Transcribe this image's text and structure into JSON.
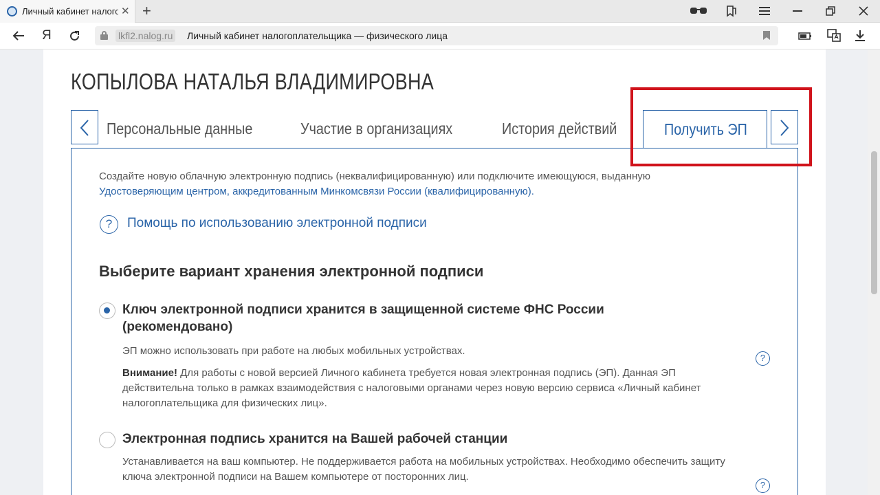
{
  "browser": {
    "tab_title": "Личный кабинет налогоплательщика",
    "tab_close": "✕",
    "new_tab": "+",
    "url_domain": "lkfl2.nalog.ru",
    "url_title": "Личный кабинет налогоплательщика — физического лица",
    "yandex_label": "Я"
  },
  "page": {
    "person_name": "КОПЫЛОВА НАТАЛЬЯ ВЛАДИМИРОВНА",
    "tabs": [
      {
        "label": "Персональные данные"
      },
      {
        "label": "Участие в организациях"
      },
      {
        "label": "История действий"
      },
      {
        "label": "Получить ЭП",
        "active": true
      }
    ],
    "intro_text_1": "Создайте новую облачную электронную подпись (неквалифицированную) или подключите имеющуюся, выданную",
    "intro_link": "Удостоверяющим центром, аккредитованным Минкомсвязи России (квалифицированную).",
    "help_icon": "?",
    "help_link": "Помощь по использованию электронной подписи",
    "section_title": "Выберите вариант хранения электронной подписи",
    "options": [
      {
        "title": "Ключ электронной подписи хранится в защищенной системе ФНС России (рекомендовано)",
        "desc": "ЭП можно использовать при работе на любых мобильных устройствах.",
        "warning_label": "Внимание!",
        "warning_text": " Для работы с новой версией Личного кабинета требуется новая электронная подпись (ЭП). Данная ЭП действительна только в рамках взаимодействия с налоговыми органами через новую версию сервиса «Личный кабинет налогоплательщика для физических лиц».",
        "selected": true
      },
      {
        "title": "Электронная подпись хранится на Вашей рабочей станции",
        "desc": "Устанавливается на ваш компьютер. Не поддерживается работа на мобильных устройствах. Необходимо обеспечить защиту ключа электронной подписи на Вашем компьютере от посторонних лиц.",
        "selected": false
      }
    ]
  },
  "colors": {
    "accent": "#2a64a8",
    "highlight": "#d0131b",
    "text": "#333333"
  }
}
